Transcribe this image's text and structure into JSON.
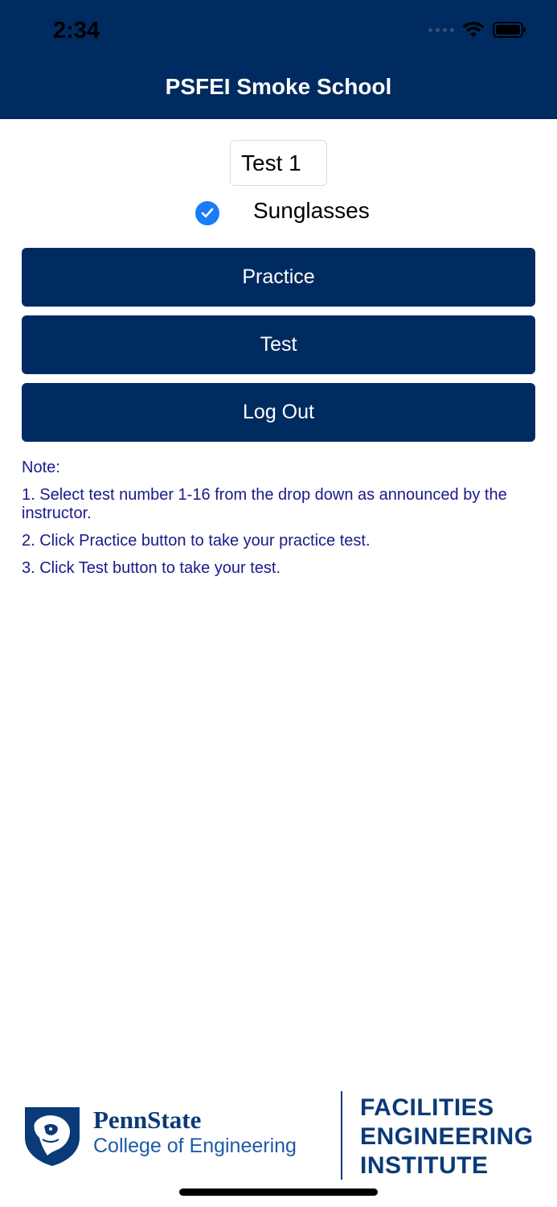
{
  "status_bar": {
    "time": "2:34"
  },
  "header": {
    "title": "PSFEI Smoke School"
  },
  "test_select": {
    "value": "Test 1"
  },
  "sunglasses": {
    "label": "Sunglasses",
    "checked": true
  },
  "buttons": {
    "practice": "Practice",
    "test": "Test",
    "logout": "Log Out"
  },
  "notes": {
    "heading": "Note:",
    "items": [
      "1. Select test number 1-16 from the drop down as announced by the instructor.",
      "2. Click Practice button to take your practice test.",
      "3. Click Test button to take your test."
    ]
  },
  "footer": {
    "brand_name": "PennState",
    "brand_college": "College of Engineering",
    "institute_lines": [
      "FACILITIES",
      "ENGINEERING",
      "INSTITUTE"
    ]
  },
  "colors": {
    "primary": "#002b60",
    "check": "#1a7cf6",
    "note_text": "#1a1a8c"
  }
}
